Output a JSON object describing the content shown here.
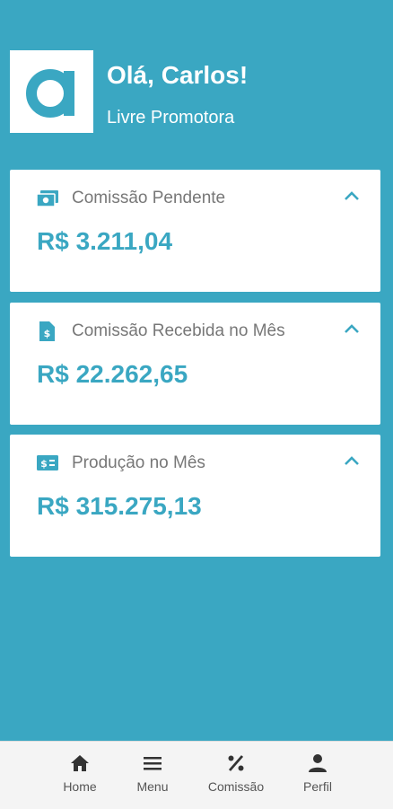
{
  "header": {
    "logo_icon": "letter-a-logo",
    "greeting": "Olá, Carlos!",
    "subtitle": "Livre Promotora"
  },
  "cards": [
    {
      "icon": "money-icon",
      "title": "Comissão Pendente",
      "amount": "R$ 3.211,04"
    },
    {
      "icon": "dollar-document-icon",
      "title": "Comissão Recebida no Mês",
      "amount": "R$ 22.262,65"
    },
    {
      "icon": "dollar-card-icon",
      "title": "Produção no Mês",
      "amount": "R$ 315.275,13"
    }
  ],
  "nav": {
    "items": [
      {
        "icon": "home-icon",
        "label": "Home"
      },
      {
        "icon": "menu-icon",
        "label": "Menu"
      },
      {
        "icon": "percent-icon",
        "label": "Comissão"
      },
      {
        "icon": "person-icon",
        "label": "Perfil"
      }
    ]
  },
  "colors": {
    "accent": "#3aa7c2",
    "card_bg": "#ffffff",
    "nav_bg": "#f4f4f4",
    "muted_text": "#777777"
  }
}
